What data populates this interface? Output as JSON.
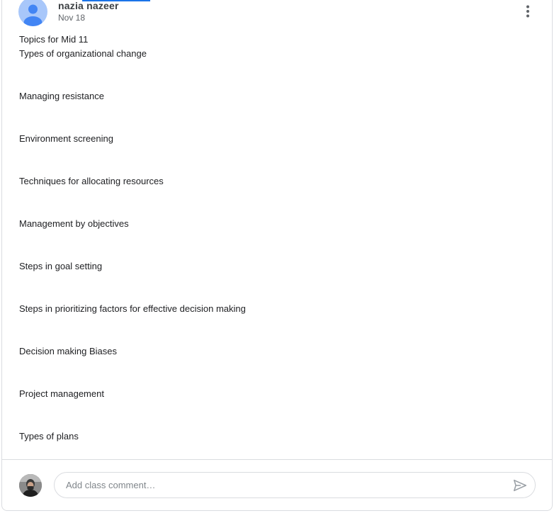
{
  "post": {
    "author": "nazia nazeer",
    "date": "Nov 18",
    "title_line": "Topics for Mid 11",
    "first_topic": "Types of organizational change",
    "topics": [
      "Managing resistance",
      "Environment screening",
      "Techniques for allocating resources",
      "Management by objectives",
      "Steps in goal setting",
      "Steps in prioritizing factors for effective decision making",
      "Decision making Biases",
      "Project management",
      "Types of plans"
    ]
  },
  "comment": {
    "placeholder": "Add class comment…",
    "value": ""
  },
  "icons": {
    "author_avatar": "default-user-avatar-icon",
    "more": "more-vert-icon",
    "user_avatar": "user-photo-avatar",
    "send": "send-icon"
  },
  "colors": {
    "accent": "#1a73e8",
    "avatar_bg": "#a8c7fa",
    "avatar_fg": "#4285f4"
  }
}
